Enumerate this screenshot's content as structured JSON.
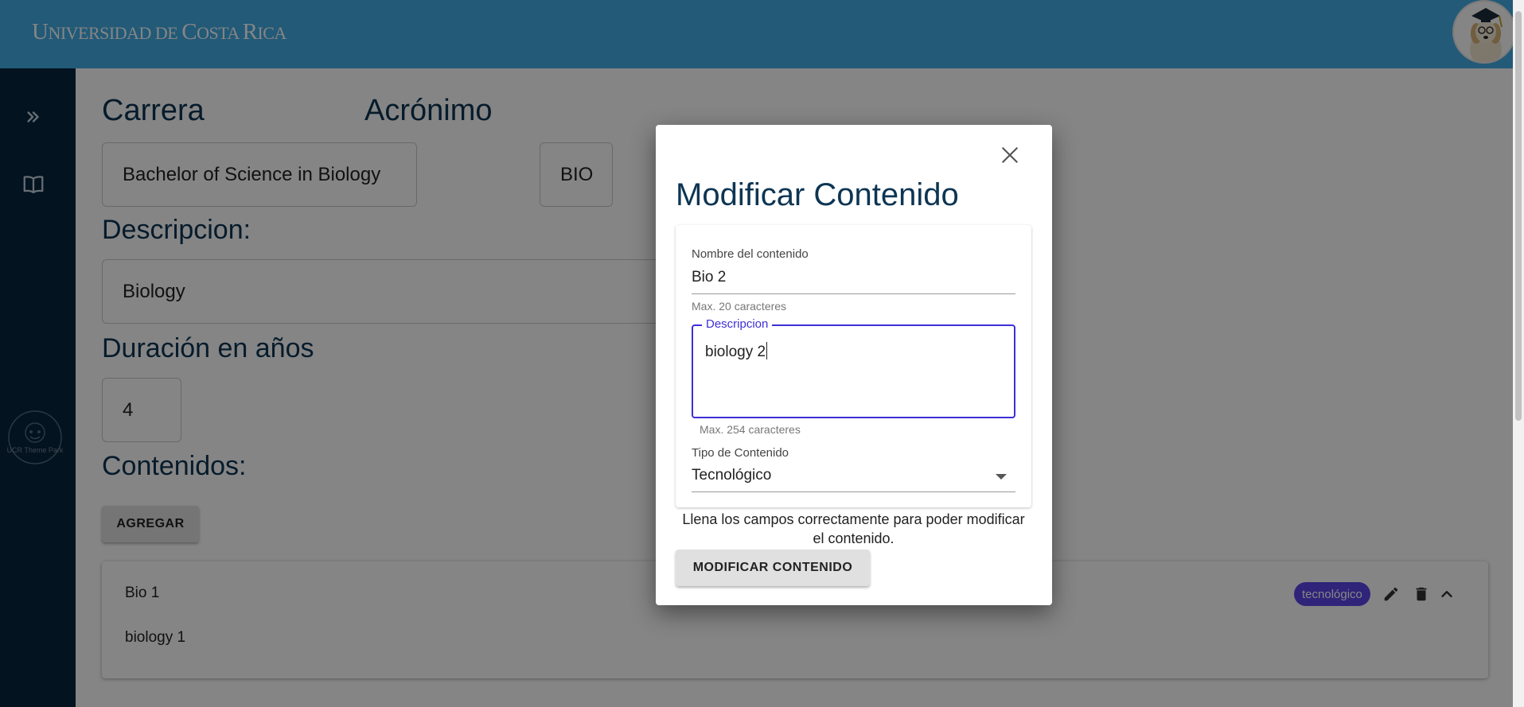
{
  "header": {
    "logo": {
      "first_letter": "U",
      "part1": "NIVERSIDAD ",
      "de": "DE ",
      "c": "C",
      "part2": "OSTA ",
      "r": "R",
      "part3": "ICA"
    },
    "avatar_icon": "dog-graduate-avatar-icon"
  },
  "sidebar": {
    "items": [
      {
        "icon": "double-chevron-right-icon"
      },
      {
        "icon": "book-icon"
      }
    ],
    "watermark": "UCR Theme Park"
  },
  "main": {
    "carrera_label": "Carrera",
    "carrera_value": "Bachelor of Science in Biology",
    "acronimo_label": "Acrónimo",
    "acronimo_value": "BIO",
    "descripcion_label": "Descripcion:",
    "descripcion_value": "Biology",
    "duracion_label": "Duración en años",
    "duracion_value": "4",
    "contenidos_label": "Contenidos:",
    "agregar_label": "AGREGAR",
    "contents": [
      {
        "name": "Bio 1",
        "description": "biology 1",
        "tag": "tecnológico"
      }
    ]
  },
  "modal": {
    "title": "Modificar Contenido",
    "nombre_label": "Nombre del contenido",
    "nombre_value": "Bio 2",
    "nombre_hint": "Max. 20 caracteres",
    "descripcion_label": "Descripcion",
    "descripcion_value": "biology 2",
    "descripcion_hint": "Max. 254 caracteres",
    "tipo_label": "Tipo de Contenido",
    "tipo_value": "Tecnológico",
    "message": "Llena los campos correctamente para poder modificar el contenido.",
    "submit_label": "MODIFICAR CONTENIDO"
  },
  "colors": {
    "header": "#41ade7",
    "sidebar": "#07263f",
    "title": "#0d3553",
    "accent": "#3d2fd6",
    "chip": "#5b46e8"
  }
}
